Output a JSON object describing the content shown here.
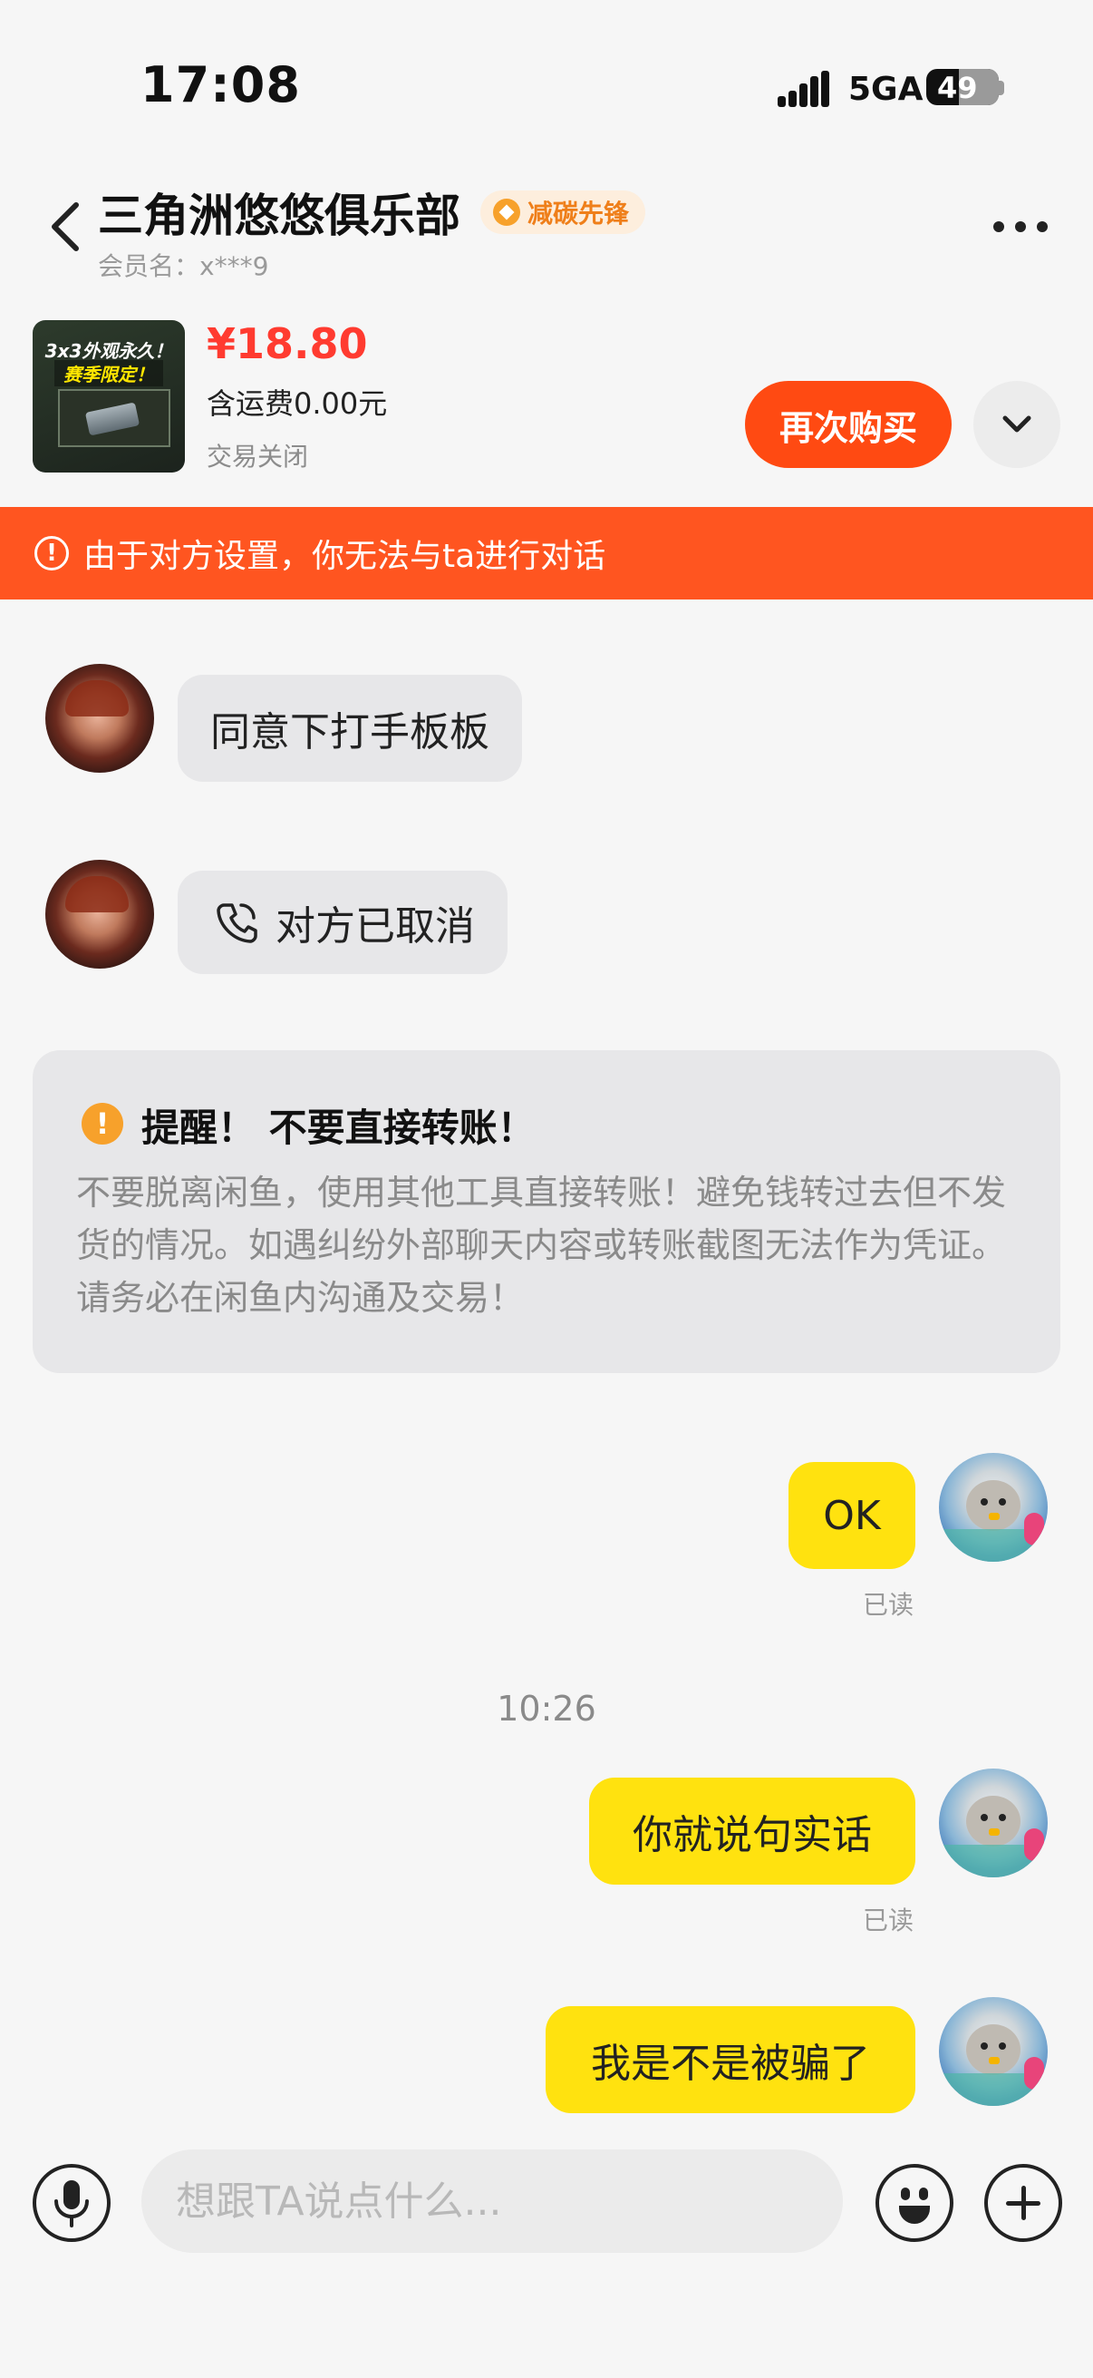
{
  "status_bar": {
    "time": "17:08",
    "network": "5GA",
    "battery": "49"
  },
  "header": {
    "title": "三角洲悠悠俱乐部",
    "badge": "减碳先锋",
    "member": "会员名：x***9"
  },
  "product": {
    "thumb_line1": "3x3外观永久！",
    "thumb_line2": "赛季限定！",
    "price": "¥18.80",
    "shipping": "含运费0.00元",
    "status": "交易关闭",
    "rebuy_label": "再次购买"
  },
  "banner": {
    "text": "由于对方设置，你无法与ta进行对话"
  },
  "messages": {
    "in_1": "同意下打手板板",
    "in_2_call": "对方已取消",
    "out_1": "OK",
    "out_1_read": "已读",
    "time_separator": "10:26",
    "out_2": "你就说句实话",
    "out_2_read": "已读",
    "out_3": "我是不是被骗了"
  },
  "reminder": {
    "title": "提醒！ 不要直接转账！",
    "body": "不要脱离闲鱼，使用其他工具直接转账！避免钱转过去但不发货的情况。如遇纠纷外部聊天内容或转账截图无法作为凭证。请务必在闲鱼内沟通及交易！"
  },
  "input_bar": {
    "placeholder": "想跟TA说点什么..."
  },
  "colors": {
    "accent_orange": "#ff4a12",
    "banner": "#ff5520",
    "outgoing_bubble": "#ffe20f",
    "price": "#ff3b30"
  }
}
